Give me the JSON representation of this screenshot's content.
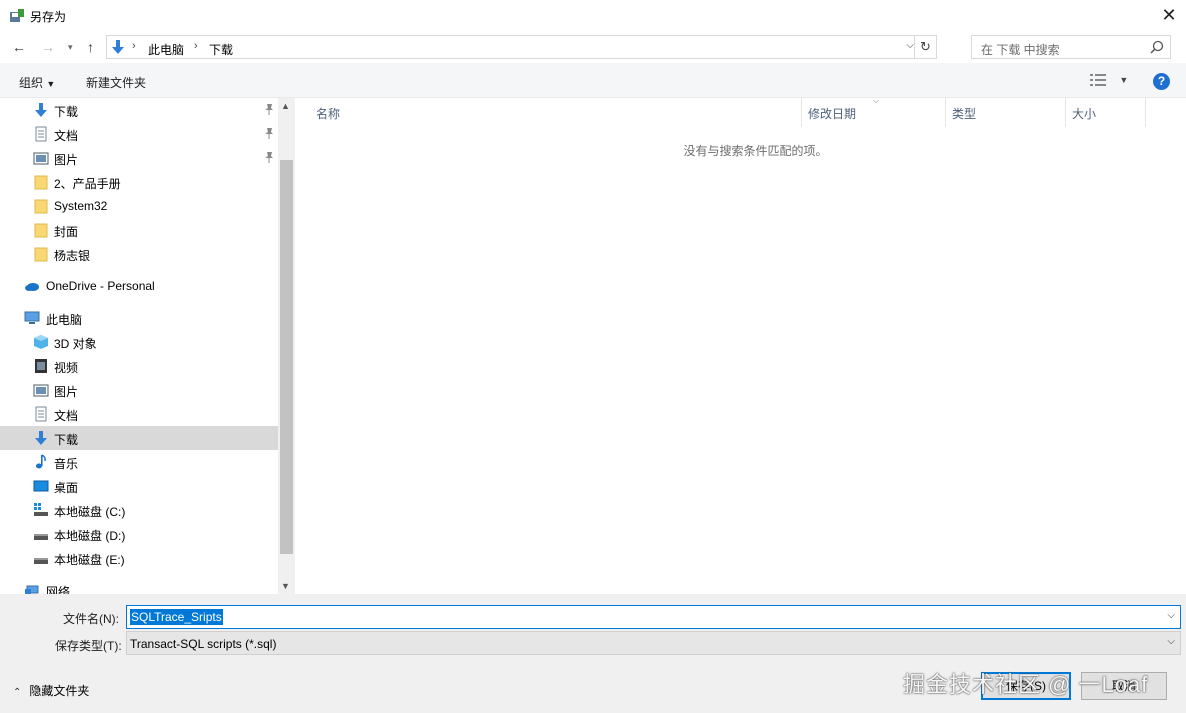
{
  "window": {
    "title": "另存为",
    "close_icon": "close-icon"
  },
  "address": {
    "crumbs": [
      "此电脑",
      "下载"
    ],
    "search_placeholder": "在 下载 中搜索"
  },
  "toolbar": {
    "organize": "组织",
    "new_folder": "新建文件夹"
  },
  "nav": {
    "items": [
      {
        "label": "下载",
        "icon": "download-icon",
        "pinned": true
      },
      {
        "label": "文档",
        "icon": "document-icon",
        "pinned": true
      },
      {
        "label": "图片",
        "icon": "pictures-icon",
        "pinned": true
      },
      {
        "label": "2、产品手册",
        "icon": "folder-icon"
      },
      {
        "label": "System32",
        "icon": "folder-icon"
      },
      {
        "label": "封面",
        "icon": "folder-icon"
      },
      {
        "label": "杨志银",
        "icon": "folder-icon"
      },
      {
        "label": "OneDrive - Personal",
        "icon": "onedrive-icon"
      },
      {
        "label": "此电脑",
        "icon": "computer-icon"
      },
      {
        "label": "3D 对象",
        "icon": "3d-objects-icon"
      },
      {
        "label": "视频",
        "icon": "video-icon"
      },
      {
        "label": "图片",
        "icon": "pictures-icon"
      },
      {
        "label": "文档",
        "icon": "document-icon"
      },
      {
        "label": "下载",
        "icon": "download-icon",
        "selected": true
      },
      {
        "label": "音乐",
        "icon": "music-icon"
      },
      {
        "label": "桌面",
        "icon": "desktop-icon"
      },
      {
        "label": "本地磁盘 (C:)",
        "icon": "drive-icon"
      },
      {
        "label": "本地磁盘 (D:)",
        "icon": "drive-icon"
      },
      {
        "label": "本地磁盘 (E:)",
        "icon": "drive-icon"
      },
      {
        "label": "网络",
        "icon": "network-icon"
      }
    ]
  },
  "columns": [
    "名称",
    "修改日期",
    "类型",
    "大小"
  ],
  "empty_message": "没有与搜索条件匹配的项。",
  "form": {
    "filename_label": "文件名(N):",
    "filename_value": "SQLTrace_Sripts",
    "filetype_label": "保存类型(T):",
    "filetype_value": "Transact-SQL scripts (*.sql)",
    "hide_folders": "隐藏文件夹",
    "save": "保存(S)",
    "cancel": "取消"
  },
  "watermark": "掘金技术社区 @ 一Loaf",
  "colors": {
    "accent": "#0078d7",
    "selected_row": "#d9d9d9",
    "help": "#1f6fd0"
  }
}
